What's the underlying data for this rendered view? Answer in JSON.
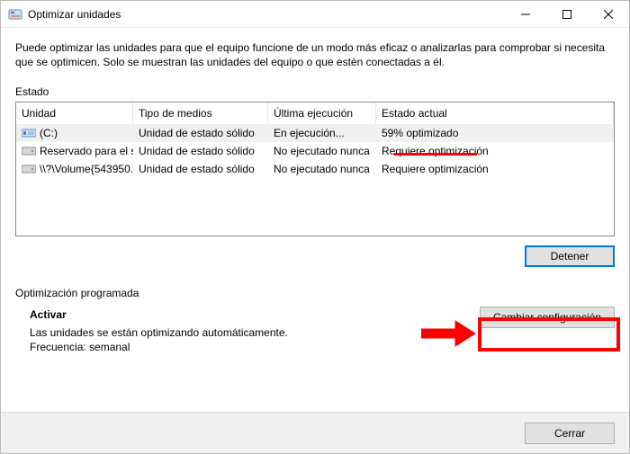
{
  "window": {
    "title": "Optimizar unidades"
  },
  "intro": "Puede optimizar las unidades para que el equipo funcione de un modo más eficaz o analizarlas para comprobar si necesita que se optimicen. Solo se muestran las unidades del equipo o que estén conectadas a él.",
  "status_label": "Estado",
  "table": {
    "headers": {
      "drive": "Unidad",
      "media": "Tipo de medios",
      "last": "Última ejecución",
      "status": "Estado actual"
    },
    "rows": [
      {
        "icon": "primary",
        "drive": "(C:)",
        "media": "Unidad de estado sólido",
        "last": "En ejecución...",
        "status": "59% optimizado",
        "selected": true
      },
      {
        "icon": "hdd",
        "drive": "Reservado para el s...",
        "media": "Unidad de estado sólido",
        "last": "No ejecutado nunca",
        "status": "Requiere optimización"
      },
      {
        "icon": "hdd",
        "drive": "\\\\?\\Volume{543950...",
        "media": "Unidad de estado sólido",
        "last": "No ejecutado nunca",
        "status": "Requiere optimización"
      }
    ]
  },
  "buttons": {
    "stop": "Detener",
    "change": "Cambiar configuración",
    "close": "Cerrar"
  },
  "scheduled": {
    "section": "Optimización programada",
    "head": "Activar",
    "line1": "Las unidades se están optimizando automáticamente.",
    "line2": "Frecuencia: semanal"
  },
  "annotation": {
    "underline_target": "59% optimizado",
    "arrow_target": "Cambiar configuración"
  }
}
